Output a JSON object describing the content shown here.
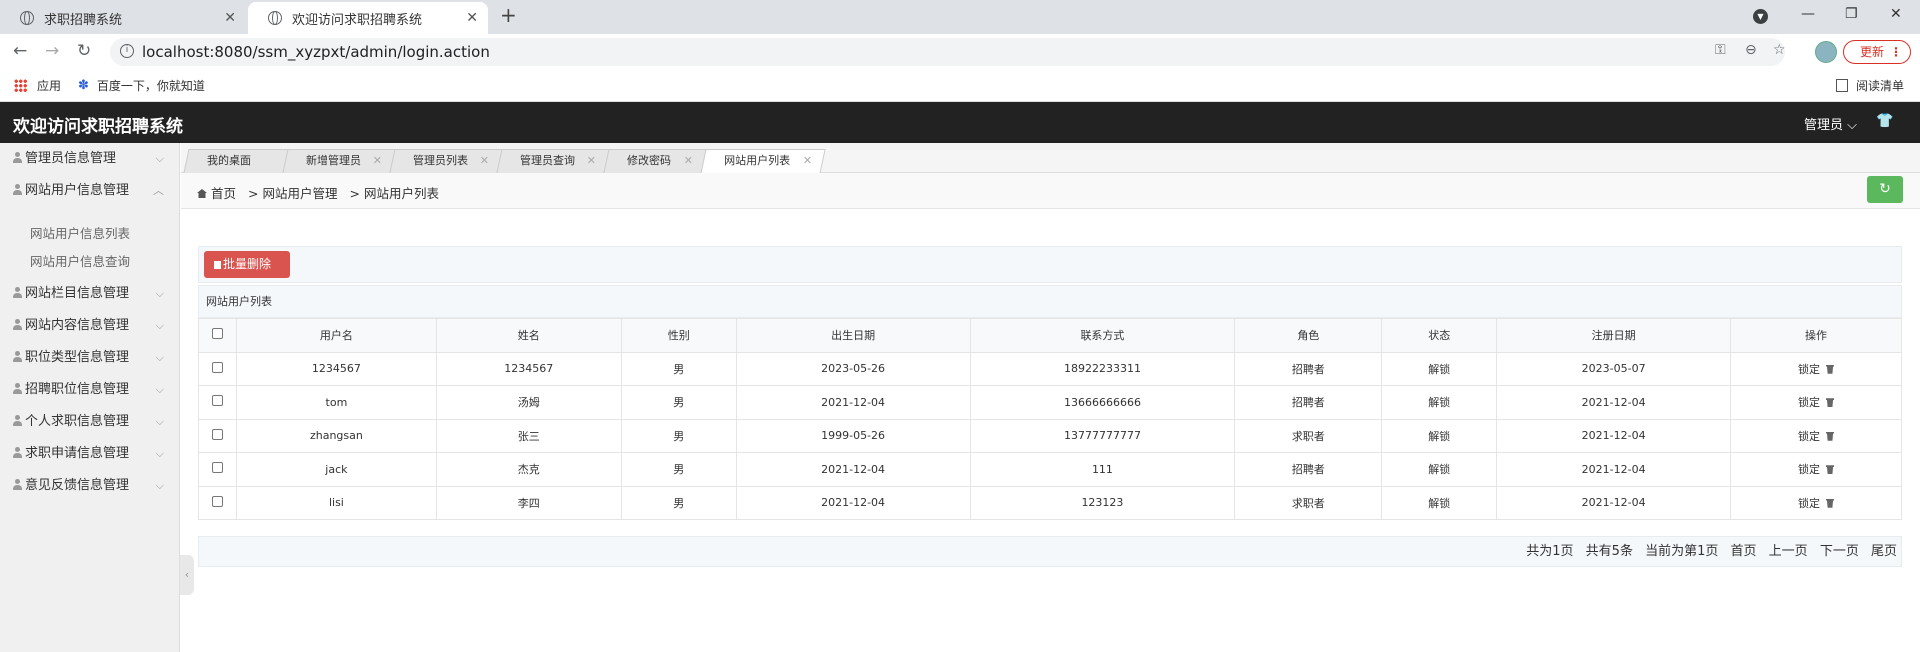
{
  "browser": {
    "tabs": [
      {
        "title": "求职招聘系统"
      },
      {
        "title": "欢迎访问求职招聘系统"
      }
    ],
    "new_tab": "+",
    "url": "localhost:8080/ssm_xyzpxt/admin/login.action",
    "update_label": "更新",
    "bookmarks": [
      {
        "label": "应用"
      },
      {
        "label": "百度一下，你就知道"
      }
    ],
    "reading_list": "阅读清单"
  },
  "app": {
    "title": "欢迎访问求职招聘系统",
    "user_menu": "管理员"
  },
  "sidebar": {
    "items": [
      {
        "label": "管理员信息管理"
      },
      {
        "label": "网站用户信息管理"
      },
      {
        "label": "网站栏目信息管理"
      },
      {
        "label": "网站内容信息管理"
      },
      {
        "label": "职位类型信息管理"
      },
      {
        "label": "招聘职位信息管理"
      },
      {
        "label": "个人求职信息管理"
      },
      {
        "label": "求职申请信息管理"
      },
      {
        "label": "意见反馈信息管理"
      }
    ],
    "subitems": [
      {
        "label": "网站用户信息列表"
      },
      {
        "label": "网站用户信息查询"
      }
    ]
  },
  "page_tabs": [
    {
      "label": "我的桌面"
    },
    {
      "label": "新增管理员"
    },
    {
      "label": "管理员列表"
    },
    {
      "label": "管理员查询"
    },
    {
      "label": "修改密码"
    },
    {
      "label": "网站用户列表"
    }
  ],
  "breadcrumb": {
    "home": "首页",
    "sep1": ">",
    "level1": "网站用户管理",
    "sep2": ">",
    "level2": "网站用户列表"
  },
  "toolbar": {
    "batch_delete": "批量删除"
  },
  "list": {
    "title": "网站用户列表",
    "columns": [
      "用户名",
      "姓名",
      "性别",
      "出生日期",
      "联系方式",
      "角色",
      "状态",
      "注册日期",
      "操作"
    ],
    "rows": [
      {
        "username": "1234567",
        "name": "1234567",
        "gender": "男",
        "birth": "2023-05-26",
        "contact": "18922233311",
        "role": "招聘者",
        "status": "解锁",
        "reg_date": "2023-05-07",
        "op": "锁定"
      },
      {
        "username": "tom",
        "name": "汤姆",
        "gender": "男",
        "birth": "2021-12-04",
        "contact": "13666666666",
        "role": "招聘者",
        "status": "解锁",
        "reg_date": "2021-12-04",
        "op": "锁定"
      },
      {
        "username": "zhangsan",
        "name": "张三",
        "gender": "男",
        "birth": "1999-05-26",
        "contact": "13777777777",
        "role": "求职者",
        "status": "解锁",
        "reg_date": "2021-12-04",
        "op": "锁定"
      },
      {
        "username": "jack",
        "name": "杰克",
        "gender": "男",
        "birth": "2021-12-04",
        "contact": "111",
        "role": "招聘者",
        "status": "解锁",
        "reg_date": "2021-12-04",
        "op": "锁定"
      },
      {
        "username": "lisi",
        "name": "李四",
        "gender": "男",
        "birth": "2021-12-04",
        "contact": "123123",
        "role": "求职者",
        "status": "解锁",
        "reg_date": "2021-12-04",
        "op": "锁定"
      }
    ]
  },
  "pager": {
    "total_pages": "共为1页",
    "total_items": "共有5条",
    "current": "当前为第1页",
    "first": "首页",
    "prev": "上一页",
    "next": "下一页",
    "last": "尾页"
  },
  "colors": {
    "header_bg": "#222222",
    "delete_btn": "#d9534f",
    "refresh_btn": "#5cb85c",
    "update_accent": "#d93025"
  }
}
